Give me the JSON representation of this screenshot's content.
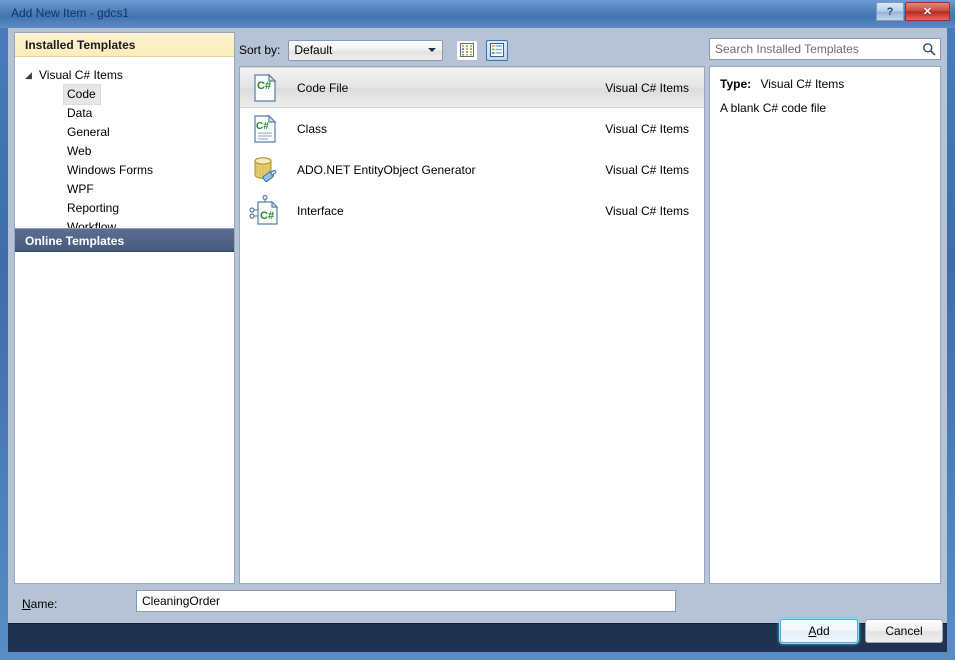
{
  "window": {
    "title": "Add New Item - gdcs1",
    "help_button": "?",
    "close_button": "✕"
  },
  "left_panel": {
    "installed_header": "Installed Templates",
    "online_header": "Online Templates",
    "tree": {
      "root_label": "Visual C# Items",
      "root_arrow": "◢",
      "children": [
        {
          "label": "Code",
          "selected": true
        },
        {
          "label": "Data",
          "selected": false
        },
        {
          "label": "General",
          "selected": false
        },
        {
          "label": "Web",
          "selected": false
        },
        {
          "label": "Windows Forms",
          "selected": false
        },
        {
          "label": "WPF",
          "selected": false
        },
        {
          "label": "Reporting",
          "selected": false
        },
        {
          "label": "Workflow",
          "selected": false
        }
      ]
    }
  },
  "toolbar": {
    "sort_by_label": "Sort by:",
    "sort_by_value": "Default",
    "view_small_icons": "small-icons-view",
    "view_medium_icons": "medium-icons-view"
  },
  "templates": {
    "items": [
      {
        "name": "Code File",
        "category": "Visual C# Items",
        "icon": "csharp-code-file-icon",
        "selected": true
      },
      {
        "name": "Class",
        "category": "Visual C# Items",
        "icon": "csharp-class-icon",
        "selected": false
      },
      {
        "name": "ADO.NET EntityObject Generator",
        "category": "Visual C# Items",
        "icon": "ado-net-entity-icon",
        "selected": false
      },
      {
        "name": "Interface",
        "category": "Visual C# Items",
        "icon": "csharp-interface-icon",
        "selected": false
      }
    ]
  },
  "search": {
    "placeholder": "Search Installed Templates",
    "value": "",
    "icon": "search-icon"
  },
  "details": {
    "type_label": "Type:",
    "type_value": "Visual C# Items",
    "description": "A blank C# code file"
  },
  "name_field": {
    "label_prefix": "",
    "label_accel": "N",
    "label_suffix": "ame:",
    "value": "CleaningOrder",
    "placeholder": ""
  },
  "buttons": {
    "add_accel": "A",
    "add_rest": "dd",
    "cancel": "Cancel"
  },
  "colors": {
    "titlebar_blue": "#4a7ebb",
    "installed_header_yellow": "#fbecbc",
    "online_header_navy": "#485a7c",
    "bottom_bar_navy": "#1f3350",
    "dialog_body": "#b6c3d7",
    "default_button_glow": "#4ab3e0",
    "csharp_green": "#1f7a1f"
  }
}
